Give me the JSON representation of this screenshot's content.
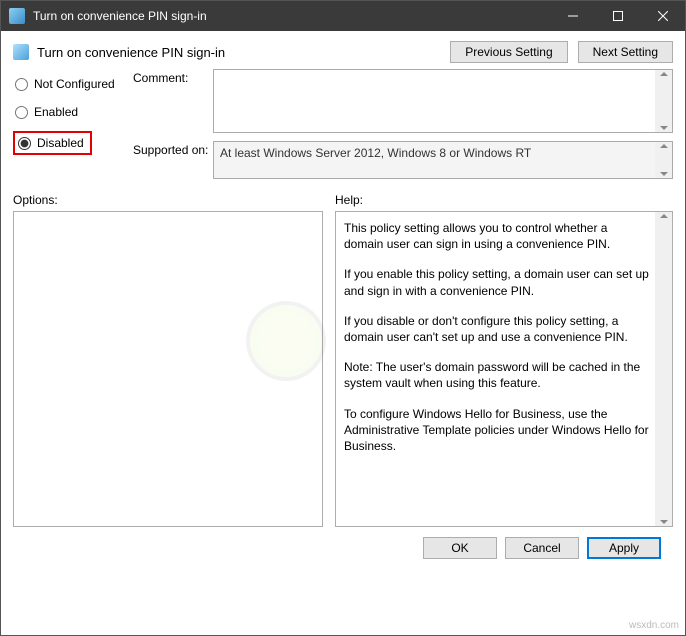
{
  "titlebar": {
    "title": "Turn on convenience PIN sign-in"
  },
  "header": {
    "title": "Turn on convenience PIN sign-in"
  },
  "nav": {
    "prev": "Previous Setting",
    "next": "Next Setting"
  },
  "radios": {
    "not_configured": "Not Configured",
    "enabled": "Enabled",
    "disabled": "Disabled"
  },
  "labels": {
    "comment": "Comment:",
    "supported": "Supported on:",
    "options": "Options:",
    "help": "Help:"
  },
  "supported_text": "At least Windows Server 2012, Windows 8 or Windows RT",
  "help_text": {
    "p1": "This policy setting allows you to control whether a domain user can sign in using a convenience PIN.",
    "p2": "If you enable this policy setting, a domain user can set up and sign in with a convenience PIN.",
    "p3": "If you disable or don't configure this policy setting, a domain user can't set up and use a convenience PIN.",
    "p4": "Note: The user's domain password will be cached in the system vault when using this feature.",
    "p5": "To configure Windows Hello for Business, use the Administrative Template policies under Windows Hello for Business."
  },
  "footer": {
    "ok": "OK",
    "cancel": "Cancel",
    "apply": "Apply"
  },
  "watermark": "wsxdn.com"
}
